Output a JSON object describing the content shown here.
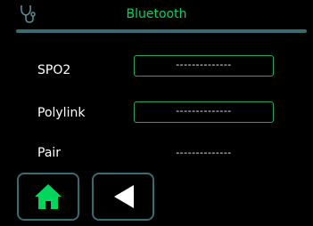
{
  "header": {
    "title": "Bluetooth",
    "icon": "stethoscope-icon",
    "title_color": "#00d65a",
    "rule_color": "#3a6a72"
  },
  "rows": [
    {
      "label": "SPO2",
      "value": "--------------"
    },
    {
      "label": "Polylink",
      "value": "--------------"
    },
    {
      "label": "Pair",
      "value": "--------------"
    }
  ],
  "footer": {
    "home_icon": "home-icon",
    "back_icon": "back-arrow-icon",
    "accent_color": "#00d65a"
  }
}
